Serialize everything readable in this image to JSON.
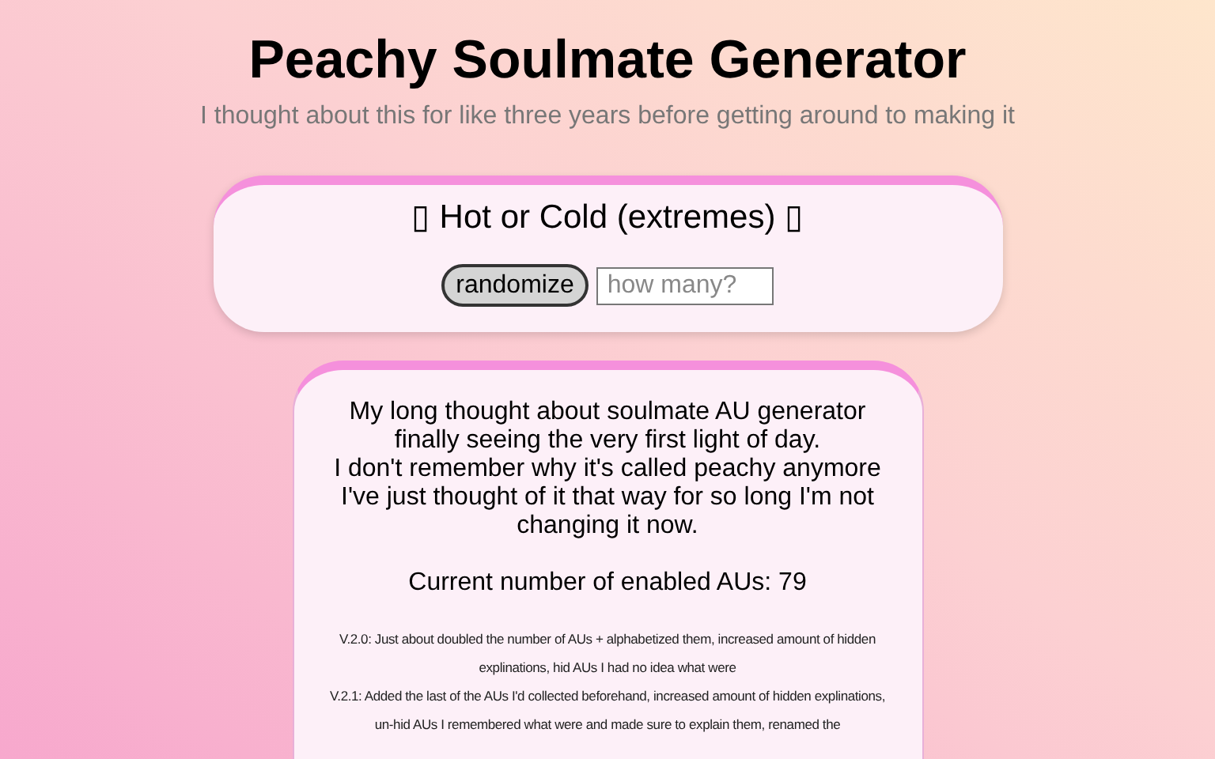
{
  "header": {
    "title": "Peachy Soulmate Generator",
    "subtitle": "I thought about this for like three years before getting around to making it"
  },
  "generator": {
    "result": "▯ Hot or Cold (extremes) ▯",
    "button": "randomize",
    "count_field": {
      "placeholder": "how many?"
    }
  },
  "about": {
    "paragraphs": [
      "My long thought about soulmate AU generator finally seeing the very first light of day.",
      "I don't remember why it's called peachy anymore",
      "I've just thought of it that way for so long I'm not changing it now."
    ],
    "count": "Current number of enabled AUs: 79",
    "changelog": [
      "V.2.0: Just about doubled the number of AUs + alphabetized them, increased amount of hidden explinations, hid AUs I had no idea what were",
      "V.2.1: Added the last of the AUs I'd collected beforehand, increased amount of hidden explinations, un-hid AUs I remembered what were and made sure to explain them, renamed the"
    ]
  }
}
